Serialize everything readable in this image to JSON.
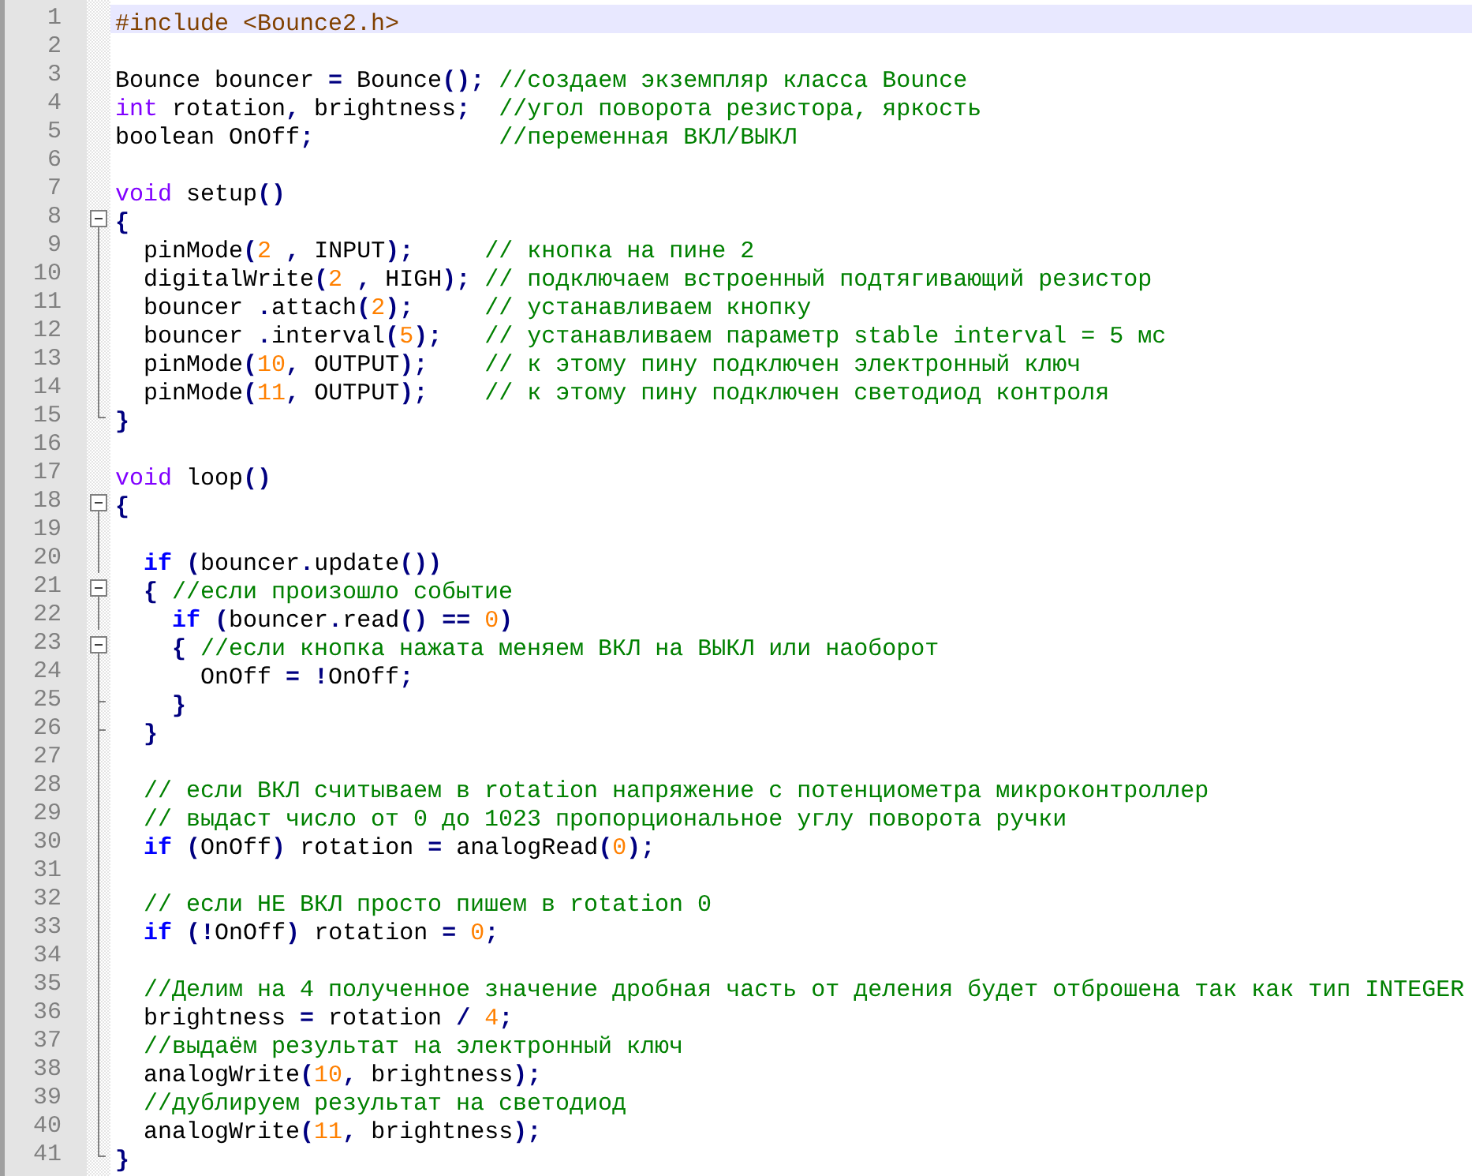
{
  "editor": {
    "lines": [
      {
        "number": "1",
        "kind": "none",
        "current": true,
        "tokens": [
          {
            "kind": "preproc",
            "text": "#include <Bounce2.h>"
          }
        ]
      },
      {
        "number": "2",
        "kind": "none",
        "current": false
      },
      {
        "number": "3",
        "kind": "none",
        "current": false,
        "tokens": [
          {
            "kind": "plain",
            "text": "Bounce bouncer "
          },
          {
            "kind": "op",
            "text": "="
          },
          {
            "kind": "plain",
            "text": " Bounce"
          },
          {
            "kind": "op",
            "text": "();"
          },
          {
            "kind": "comment",
            "text": " //создаем экземпляр класса Bounce"
          }
        ]
      },
      {
        "number": "4",
        "kind": "none",
        "current": false,
        "tokens": [
          {
            "kind": "type",
            "text": "int"
          },
          {
            "kind": "plain",
            "text": " rotation"
          },
          {
            "kind": "op",
            "text": ","
          },
          {
            "kind": "plain",
            "text": " brightness"
          },
          {
            "kind": "op",
            "text": ";"
          },
          {
            "kind": "comment",
            "text": "  //угол поворота резистора, яркость"
          }
        ]
      },
      {
        "number": "5",
        "kind": "none",
        "current": false,
        "tokens": [
          {
            "kind": "plain",
            "text": "boolean OnOff"
          },
          {
            "kind": "op",
            "text": ";"
          },
          {
            "kind": "comment",
            "text": "             //переменная ВКЛ/ВЫКЛ"
          }
        ]
      },
      {
        "number": "6",
        "kind": "none",
        "current": false
      },
      {
        "number": "7",
        "kind": "none",
        "current": false,
        "tokens": [
          {
            "kind": "type",
            "text": "void"
          },
          {
            "kind": "plain",
            "text": " setup"
          },
          {
            "kind": "op",
            "text": "()"
          }
        ]
      },
      {
        "number": "8",
        "kind": "start",
        "current": false,
        "tokens": [
          {
            "kind": "op",
            "text": "{"
          }
        ]
      },
      {
        "number": "9",
        "kind": "body",
        "current": false,
        "tokens": [
          {
            "kind": "plain",
            "text": "  pinMode"
          },
          {
            "kind": "op",
            "text": "("
          },
          {
            "kind": "number",
            "text": "2"
          },
          {
            "kind": "op",
            "text": " ,"
          },
          {
            "kind": "plain",
            "text": " INPUT"
          },
          {
            "kind": "op",
            "text": ");"
          },
          {
            "kind": "comment",
            "text": "     // кнопка на пине 2"
          }
        ]
      },
      {
        "number": "10",
        "kind": "body",
        "current": false,
        "tokens": [
          {
            "kind": "plain",
            "text": "  digitalWrite"
          },
          {
            "kind": "op",
            "text": "("
          },
          {
            "kind": "number",
            "text": "2"
          },
          {
            "kind": "op",
            "text": " ,"
          },
          {
            "kind": "plain",
            "text": " HIGH"
          },
          {
            "kind": "op",
            "text": ");"
          },
          {
            "kind": "comment",
            "text": " // подключаем встроенный подтягивающий резистор"
          }
        ]
      },
      {
        "number": "11",
        "kind": "body",
        "current": false,
        "tokens": [
          {
            "kind": "plain",
            "text": "  bouncer "
          },
          {
            "kind": "op",
            "text": "."
          },
          {
            "kind": "plain",
            "text": "attach"
          },
          {
            "kind": "op",
            "text": "("
          },
          {
            "kind": "number",
            "text": "2"
          },
          {
            "kind": "op",
            "text": ");"
          },
          {
            "kind": "comment",
            "text": "     // устанавливаем кнопку"
          }
        ]
      },
      {
        "number": "12",
        "kind": "body",
        "current": false,
        "tokens": [
          {
            "kind": "plain",
            "text": "  bouncer "
          },
          {
            "kind": "op",
            "text": "."
          },
          {
            "kind": "plain",
            "text": "interval"
          },
          {
            "kind": "op",
            "text": "("
          },
          {
            "kind": "number",
            "text": "5"
          },
          {
            "kind": "op",
            "text": ");"
          },
          {
            "kind": "comment",
            "text": "   // устанавливаем параметр stable interval = 5 мс"
          }
        ]
      },
      {
        "number": "13",
        "kind": "body",
        "current": false,
        "tokens": [
          {
            "kind": "plain",
            "text": "  pinMode"
          },
          {
            "kind": "op",
            "text": "("
          },
          {
            "kind": "number",
            "text": "10"
          },
          {
            "kind": "op",
            "text": ","
          },
          {
            "kind": "plain",
            "text": " OUTPUT"
          },
          {
            "kind": "op",
            "text": ");"
          },
          {
            "kind": "comment",
            "text": "    // к этому пину подключен электронный ключ"
          }
        ]
      },
      {
        "number": "14",
        "kind": "body",
        "current": false,
        "tokens": [
          {
            "kind": "plain",
            "text": "  pinMode"
          },
          {
            "kind": "op",
            "text": "("
          },
          {
            "kind": "number",
            "text": "11"
          },
          {
            "kind": "op",
            "text": ","
          },
          {
            "kind": "plain",
            "text": " OUTPUT"
          },
          {
            "kind": "op",
            "text": ");"
          },
          {
            "kind": "comment",
            "text": "    // к этому пину подключен светодиод контроля"
          }
        ]
      },
      {
        "number": "15",
        "kind": "end",
        "current": false,
        "tokens": [
          {
            "kind": "op",
            "text": "}"
          }
        ]
      },
      {
        "number": "16",
        "kind": "none",
        "current": false
      },
      {
        "number": "17",
        "kind": "none",
        "current": false,
        "tokens": [
          {
            "kind": "type",
            "text": "void"
          },
          {
            "kind": "plain",
            "text": " loop"
          },
          {
            "kind": "op",
            "text": "()"
          }
        ]
      },
      {
        "number": "18",
        "kind": "start",
        "current": false,
        "tokens": [
          {
            "kind": "op",
            "text": "{"
          }
        ]
      },
      {
        "number": "19",
        "kind": "body",
        "current": false
      },
      {
        "number": "20",
        "kind": "body",
        "current": false,
        "tokens": [
          {
            "kind": "keyword",
            "text": "  if"
          },
          {
            "kind": "op",
            "text": " ("
          },
          {
            "kind": "plain",
            "text": "bouncer"
          },
          {
            "kind": "op",
            "text": "."
          },
          {
            "kind": "plain",
            "text": "update"
          },
          {
            "kind": "op",
            "text": "())"
          }
        ]
      },
      {
        "number": "21",
        "kind": "start",
        "current": false,
        "tokens": [
          {
            "kind": "op",
            "text": "  {"
          },
          {
            "kind": "comment",
            "text": " //если произошло событие"
          }
        ]
      },
      {
        "number": "22",
        "kind": "body",
        "current": false,
        "tokens": [
          {
            "kind": "keyword",
            "text": "    if"
          },
          {
            "kind": "op",
            "text": " ("
          },
          {
            "kind": "plain",
            "text": "bouncer"
          },
          {
            "kind": "op",
            "text": "."
          },
          {
            "kind": "plain",
            "text": "read"
          },
          {
            "kind": "op",
            "text": "() =="
          },
          {
            "kind": "number",
            "text": " 0"
          },
          {
            "kind": "op",
            "text": ")"
          }
        ]
      },
      {
        "number": "23",
        "kind": "start",
        "current": false,
        "tokens": [
          {
            "kind": "op",
            "text": "    {"
          },
          {
            "kind": "comment",
            "text": " //если кнопка нажата меняем ВКЛ на ВЫКЛ или наоборот"
          }
        ]
      },
      {
        "number": "24",
        "kind": "body",
        "current": false,
        "tokens": [
          {
            "kind": "plain",
            "text": "      OnOff "
          },
          {
            "kind": "op",
            "text": "= !"
          },
          {
            "kind": "plain",
            "text": "OnOff"
          },
          {
            "kind": "op",
            "text": ";"
          }
        ]
      },
      {
        "number": "25",
        "kind": "tee",
        "current": false,
        "tokens": [
          {
            "kind": "op",
            "text": "    }"
          }
        ]
      },
      {
        "number": "26",
        "kind": "tee",
        "current": false,
        "tokens": [
          {
            "kind": "op",
            "text": "  }"
          }
        ]
      },
      {
        "number": "27",
        "kind": "body",
        "current": false
      },
      {
        "number": "28",
        "kind": "body",
        "current": false,
        "tokens": [
          {
            "kind": "comment",
            "text": "  // если ВКЛ считываем в rotation напряжение с потенциометра микроконтроллер"
          }
        ]
      },
      {
        "number": "29",
        "kind": "body",
        "current": false,
        "tokens": [
          {
            "kind": "comment",
            "text": "  // выдаст число от 0 до 1023 пропорциональное углу поворота ручки"
          }
        ]
      },
      {
        "number": "30",
        "kind": "body",
        "current": false,
        "tokens": [
          {
            "kind": "keyword",
            "text": "  if"
          },
          {
            "kind": "op",
            "text": " ("
          },
          {
            "kind": "plain",
            "text": "OnOff"
          },
          {
            "kind": "op",
            "text": ")"
          },
          {
            "kind": "plain",
            "text": " rotation "
          },
          {
            "kind": "op",
            "text": "="
          },
          {
            "kind": "plain",
            "text": " analogRead"
          },
          {
            "kind": "op",
            "text": "("
          },
          {
            "kind": "number",
            "text": "0"
          },
          {
            "kind": "op",
            "text": ");"
          }
        ]
      },
      {
        "number": "31",
        "kind": "body",
        "current": false
      },
      {
        "number": "32",
        "kind": "body",
        "current": false,
        "tokens": [
          {
            "kind": "comment",
            "text": "  // если НЕ ВКЛ просто пишем в rotation 0"
          }
        ]
      },
      {
        "number": "33",
        "kind": "body",
        "current": false,
        "tokens": [
          {
            "kind": "keyword",
            "text": "  if"
          },
          {
            "kind": "op",
            "text": " (!"
          },
          {
            "kind": "plain",
            "text": "OnOff"
          },
          {
            "kind": "op",
            "text": ")"
          },
          {
            "kind": "plain",
            "text": " rotation "
          },
          {
            "kind": "op",
            "text": "="
          },
          {
            "kind": "number",
            "text": " 0"
          },
          {
            "kind": "op",
            "text": ";"
          }
        ]
      },
      {
        "number": "34",
        "kind": "body",
        "current": false
      },
      {
        "number": "35",
        "kind": "body",
        "current": false,
        "tokens": [
          {
            "kind": "comment",
            "text": "  //Делим на 4 полученное значение дробная часть от деления будет отброшена так как тип INTEGER"
          }
        ]
      },
      {
        "number": "36",
        "kind": "body",
        "current": false,
        "tokens": [
          {
            "kind": "plain",
            "text": "  brightness "
          },
          {
            "kind": "op",
            "text": "="
          },
          {
            "kind": "plain",
            "text": " rotation "
          },
          {
            "kind": "op",
            "text": "/"
          },
          {
            "kind": "number",
            "text": " 4"
          },
          {
            "kind": "op",
            "text": ";"
          }
        ]
      },
      {
        "number": "37",
        "kind": "body",
        "current": false,
        "tokens": [
          {
            "kind": "comment",
            "text": "  //выдаём результат на электронный ключ"
          }
        ]
      },
      {
        "number": "38",
        "kind": "body",
        "current": false,
        "tokens": [
          {
            "kind": "plain",
            "text": "  analogWrite"
          },
          {
            "kind": "op",
            "text": "("
          },
          {
            "kind": "number",
            "text": "10"
          },
          {
            "kind": "op",
            "text": ","
          },
          {
            "kind": "plain",
            "text": " brightness"
          },
          {
            "kind": "op",
            "text": ");"
          }
        ]
      },
      {
        "number": "39",
        "kind": "body",
        "current": false,
        "tokens": [
          {
            "kind": "comment",
            "text": "  //дублируем результат на светодиод"
          }
        ]
      },
      {
        "number": "40",
        "kind": "body",
        "current": false,
        "tokens": [
          {
            "kind": "plain",
            "text": "  analogWrite"
          },
          {
            "kind": "op",
            "text": "("
          },
          {
            "kind": "number",
            "text": "11"
          },
          {
            "kind": "op",
            "text": ","
          },
          {
            "kind": "plain",
            "text": " brightness"
          },
          {
            "kind": "op",
            "text": ");"
          }
        ]
      },
      {
        "number": "41",
        "kind": "end",
        "current": false,
        "tokens": [
          {
            "kind": "op",
            "text": "}"
          }
        ]
      }
    ]
  }
}
